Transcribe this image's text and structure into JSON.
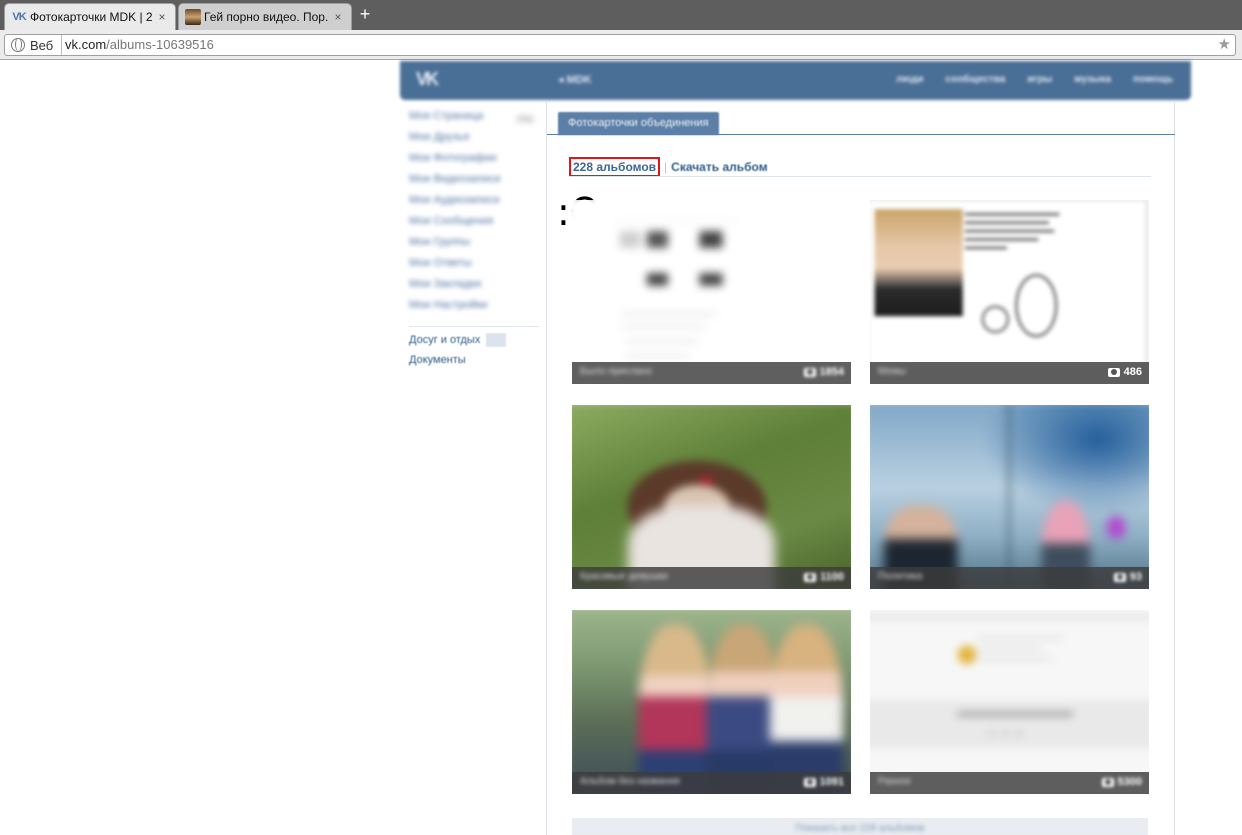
{
  "browser": {
    "tabs": [
      {
        "title": "Фотокарточки MDK | 2...",
        "active": true,
        "favicon": "vk-logo-icon"
      },
      {
        "title": "Гей порно видео. Пор...",
        "active": false,
        "favicon": "thumbnail-icon"
      }
    ],
    "close_glyph": "×",
    "new_tab_glyph": "+",
    "address_chip": "Веб",
    "url_host": "vk.com",
    "url_path": "/albums-10639516"
  },
  "vk": {
    "logo": "VK",
    "back_link": "MDK",
    "top_menu": [
      "люди",
      "сообщества",
      "игры",
      "музыка",
      "помощь"
    ],
    "sidebar": [
      {
        "label": "Моя Страница",
        "badge": "ред."
      },
      {
        "label": "Мои Друзья"
      },
      {
        "label": "Мои Фотографии"
      },
      {
        "label": "Мои Видеозаписи"
      },
      {
        "label": "Мои Аудиозаписи"
      },
      {
        "label": "Мои Сообщения"
      },
      {
        "label": "Мои Группы"
      },
      {
        "label": "Мои Ответы"
      },
      {
        "label": "Мои Закладки"
      },
      {
        "label": "Мои Настройки"
      }
    ],
    "sidebar_extra": [
      {
        "label": "Досуг и отдых"
      },
      {
        "label": "Документы"
      }
    ],
    "page_tab": "Фотокарточки объединения",
    "album_count": "228 альбомов",
    "download_album": "Скачать альбом",
    "annotation": ":O",
    "albums": [
      {
        "title": "Было прислано",
        "count": "1854"
      },
      {
        "title": "Мемы",
        "count": "486"
      },
      {
        "title": "Красивые девушки",
        "count": "1100"
      },
      {
        "title": "Политика",
        "count": "93"
      },
      {
        "title": "Альбом без названия",
        "count": "1091"
      },
      {
        "title": "Разное",
        "count": "5300"
      }
    ],
    "show_all": "Показать все 228 альбомов"
  }
}
